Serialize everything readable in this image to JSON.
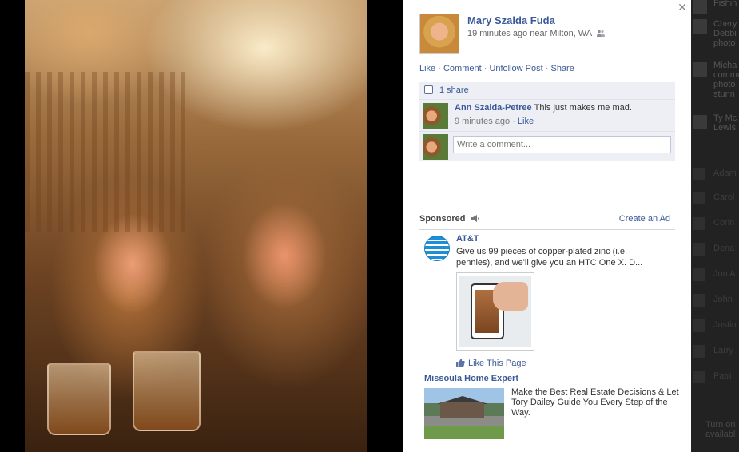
{
  "post": {
    "author": "Mary Szalda Fuda",
    "time": "19 minutes ago near Milton, WA",
    "audience_icon": "people-icon",
    "actions": [
      "Like",
      "Comment",
      "Unfollow Post",
      "Share"
    ],
    "shares": "1 share",
    "comments": [
      {
        "name": "Ann Szalda-Petree",
        "text": "This just makes me mad.",
        "time": "9 minutes ago",
        "like": "Like"
      }
    ],
    "composer_placeholder": "Write a comment..."
  },
  "sponsored": {
    "label": "Sponsored",
    "create_ad": "Create an Ad",
    "ads": [
      {
        "title": "AT&T",
        "body": "Give us 99 pieces of copper-plated zinc (i.e. pennies), and we'll give you an HTC One X. D...",
        "like_page": "Like This Page"
      },
      {
        "title": "Missoula Home Expert",
        "body": "Make the Best Real Estate Decisions & Let Tory Dailey Guide You Every Step of the Way."
      }
    ]
  },
  "ticker": {
    "items": [
      "Fishin",
      "Chery Debbi photo",
      "Micha comme photo stunn",
      "Ty Mc Lewis"
    ],
    "chat": [
      "Adam",
      "Carol",
      "Corin",
      "Dena",
      "Jon A",
      "John",
      "Justin",
      "Larry",
      "Patri"
    ],
    "footer": "Turn on availabl"
  },
  "colors": {
    "link": "#3b5998",
    "ufi_bg": "#edeff4",
    "backdrop": "#000000"
  }
}
